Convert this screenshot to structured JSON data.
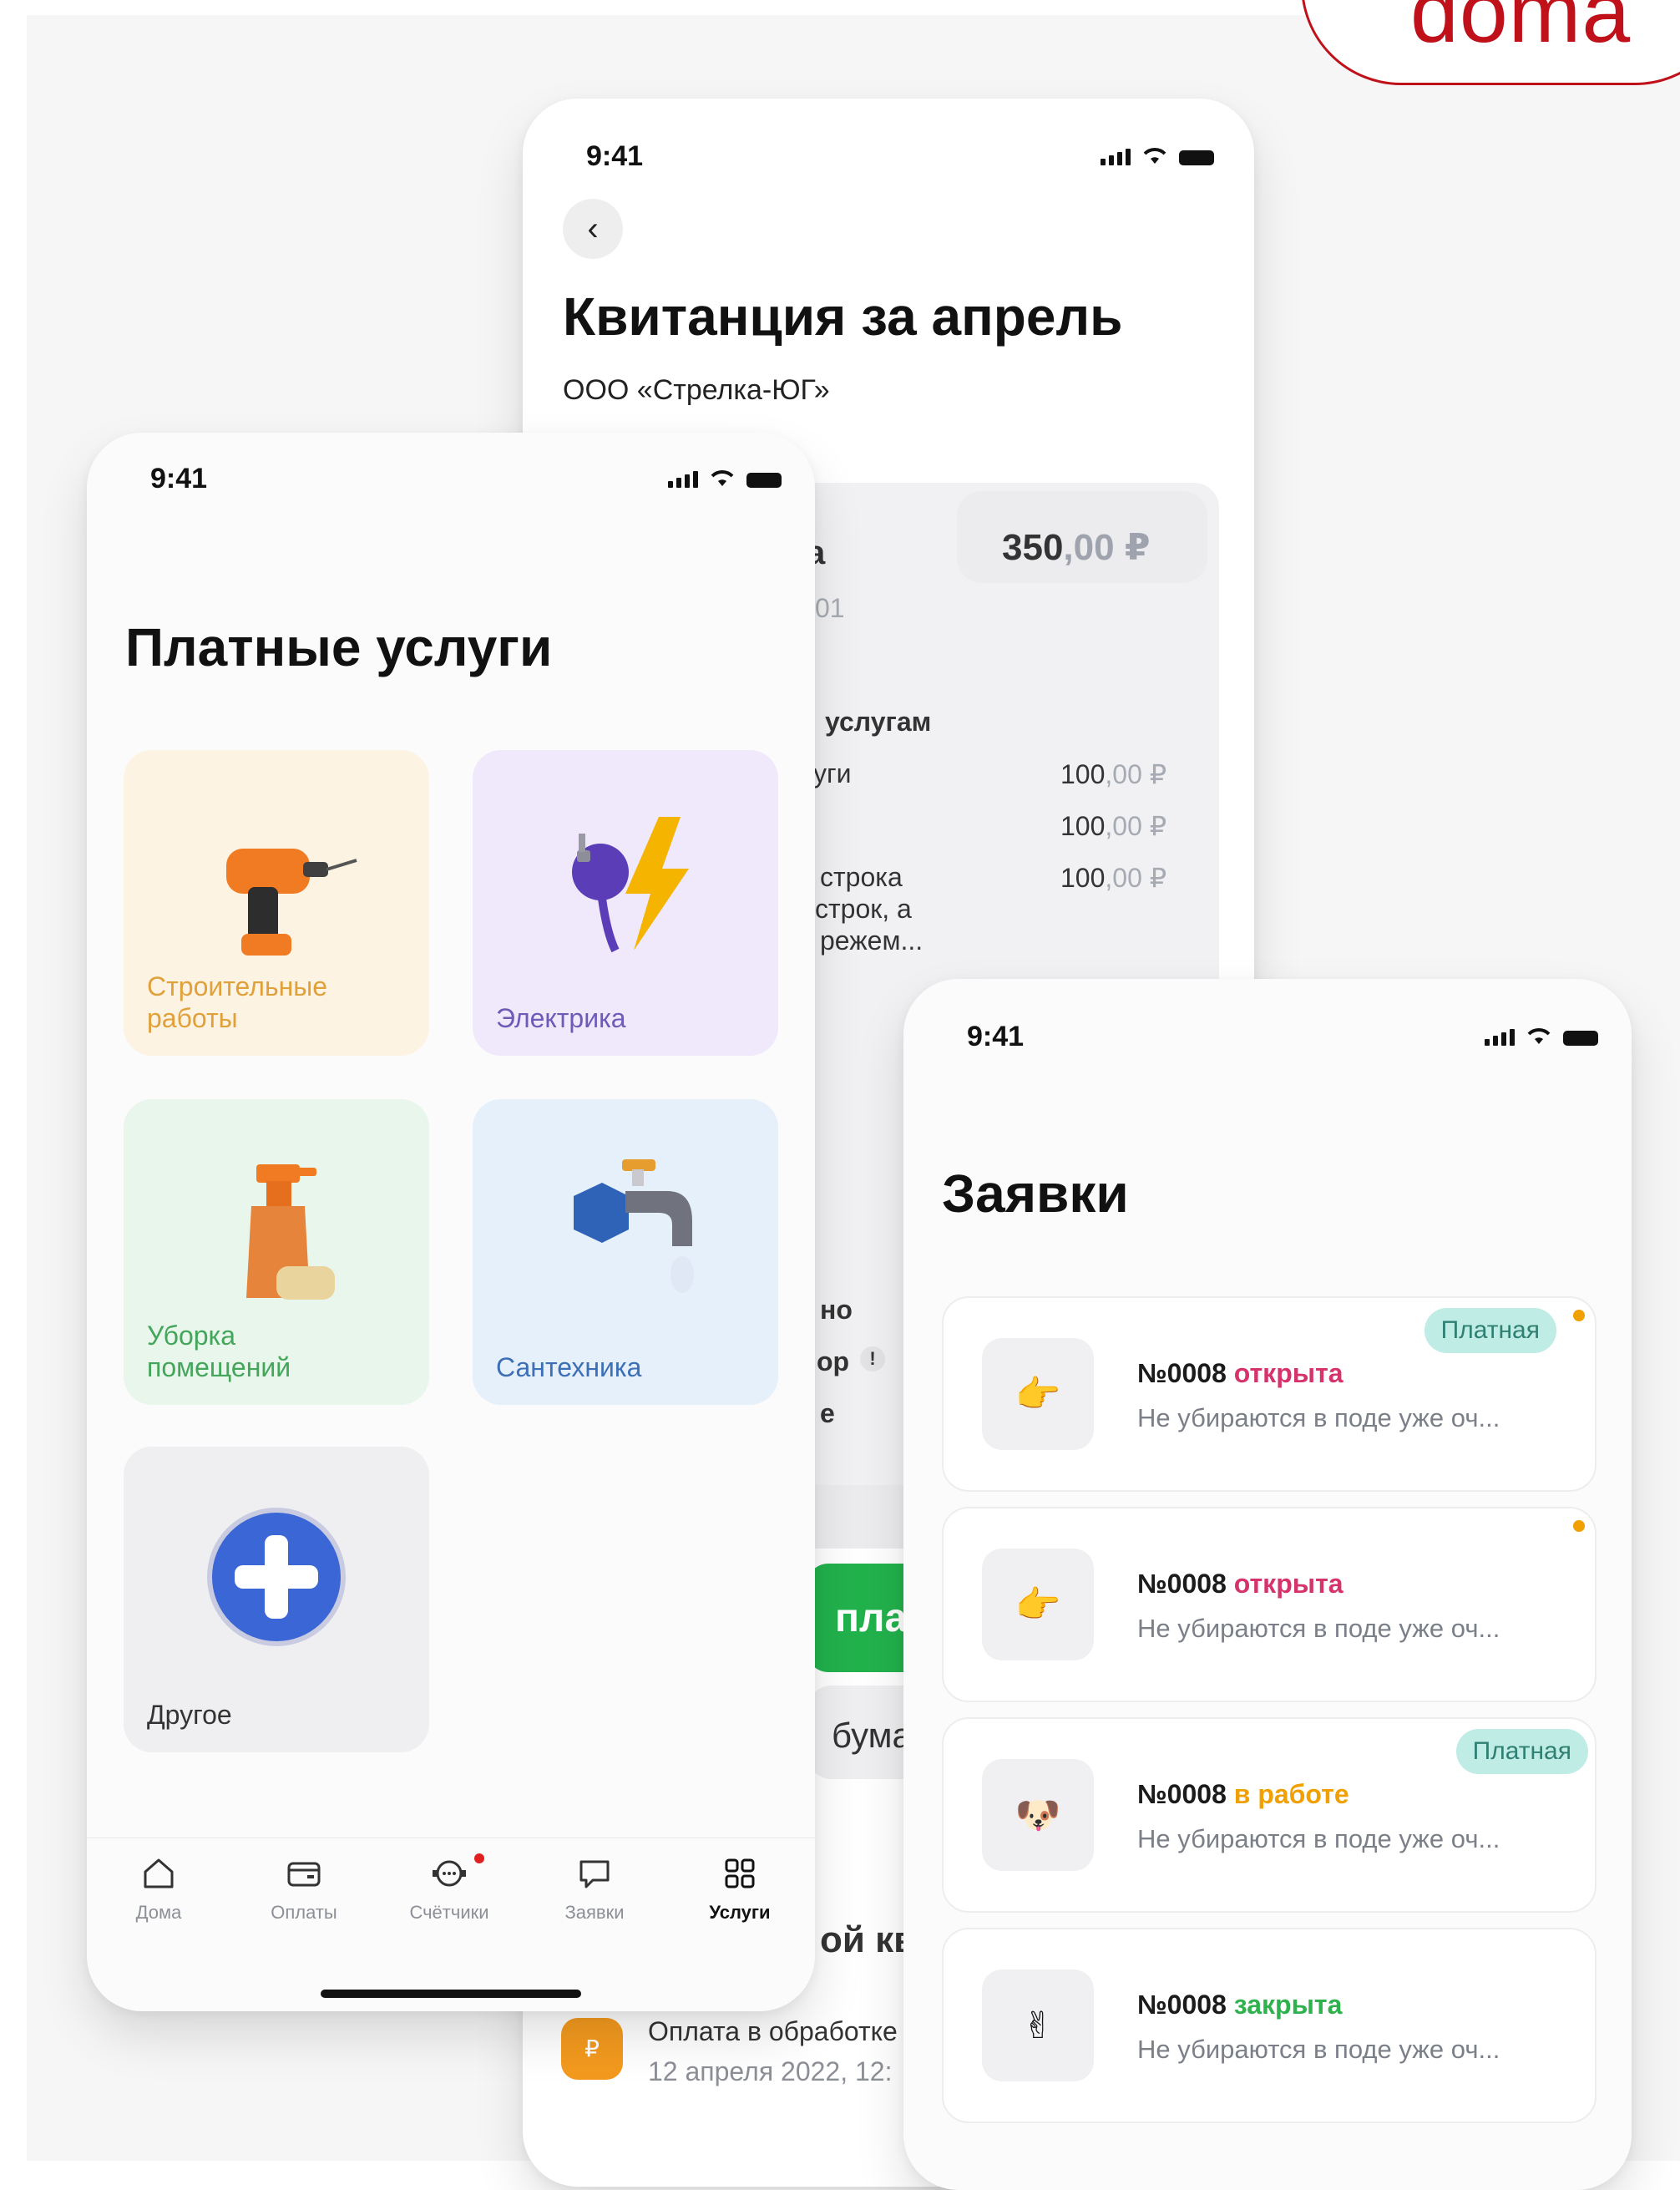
{
  "brand": {
    "text": "doma"
  },
  "receipt_screen": {
    "status_time": "9:41",
    "back_icon": "‹",
    "title": "Квитанция за апрель",
    "company": "ООО «Стрелка-ЮГ»",
    "partial_label_1": "а",
    "amount_int": "350",
    "amount_dec": ",00 ₽",
    "partial_account": "01",
    "section_heading": "услугам",
    "lines": [
      {
        "label": "уги",
        "int": "100",
        "dec": ",00 ₽"
      },
      {
        "label": "",
        "int": "100",
        "dec": ",00 ₽"
      },
      {
        "label": "строка",
        "int": "100",
        "dec": ",00 ₽"
      }
    ],
    "wrap_line_1": "строк, а",
    "wrap_line_2": "режем...",
    "partial_no": "но",
    "partial_op": "ор",
    "info_mark": "!",
    "partial_e": "е",
    "pay_button_partial": "плат",
    "paper_partial": "бумаж",
    "receipt_partial": "ой кв",
    "status_item": {
      "icon_letter": "₽",
      "title": "Оплата в обработке",
      "date": "12 апреля 2022, 12:"
    }
  },
  "services_screen": {
    "status_time": "9:41",
    "title": "Платные услуги",
    "tiles": [
      {
        "label_line1": "Строительные",
        "label_line2": "работы",
        "color": "#e9b24c",
        "bg": "#fdf3e3",
        "icon": "drill-icon"
      },
      {
        "label_line1": "Электрика",
        "label_line2": "",
        "color": "#6e5bb8",
        "bg": "#f0e8fb",
        "icon": "plug-lightning-icon"
      },
      {
        "label_line1": "Уборка",
        "label_line2": "помещений",
        "color": "#43a65a",
        "bg": "#e8f6ec",
        "icon": "spray-bottle-icon"
      },
      {
        "label_line1": "Сантехника",
        "label_line2": "",
        "color": "#3d6fb6",
        "bg": "#e6f0fb",
        "icon": "faucet-icon"
      },
      {
        "label_line1": "Другое",
        "label_line2": "",
        "color": "#333333",
        "bg": "#efeff1",
        "icon": "plus-icon"
      }
    ],
    "tabs": [
      {
        "label": "Дома",
        "icon": "home-icon"
      },
      {
        "label": "Оплаты",
        "icon": "wallet-icon"
      },
      {
        "label": "Счётчики",
        "icon": "meter-icon"
      },
      {
        "label": "Заявки",
        "icon": "chat-icon"
      },
      {
        "label": "Услуги",
        "icon": "grid-icon"
      }
    ]
  },
  "requests_screen": {
    "status_time": "9:41",
    "title": "Заявки",
    "items": [
      {
        "number": "№0008",
        "status": "открыта",
        "status_color": "#d6336c",
        "desc": "Не убираются в поде уже оч...",
        "badge": "Платная",
        "dot": true,
        "emoji": "👉"
      },
      {
        "number": "№0008",
        "status": "открыта",
        "status_color": "#d6336c",
        "desc": "Не убираются в поде уже оч...",
        "badge": "",
        "dot": true,
        "emoji": "👉"
      },
      {
        "number": "№0008",
        "status": "в работе",
        "status_color": "#f0a000",
        "desc": "Не убираются в поде уже оч...",
        "badge": "Платная",
        "dot": false,
        "emoji": "🐶"
      },
      {
        "number": "№0008",
        "status": "закрыта",
        "status_color": "#2fb24e",
        "desc": "Не убираются в поде уже оч...",
        "badge": "",
        "dot": false,
        "emoji": "✌"
      }
    ]
  }
}
